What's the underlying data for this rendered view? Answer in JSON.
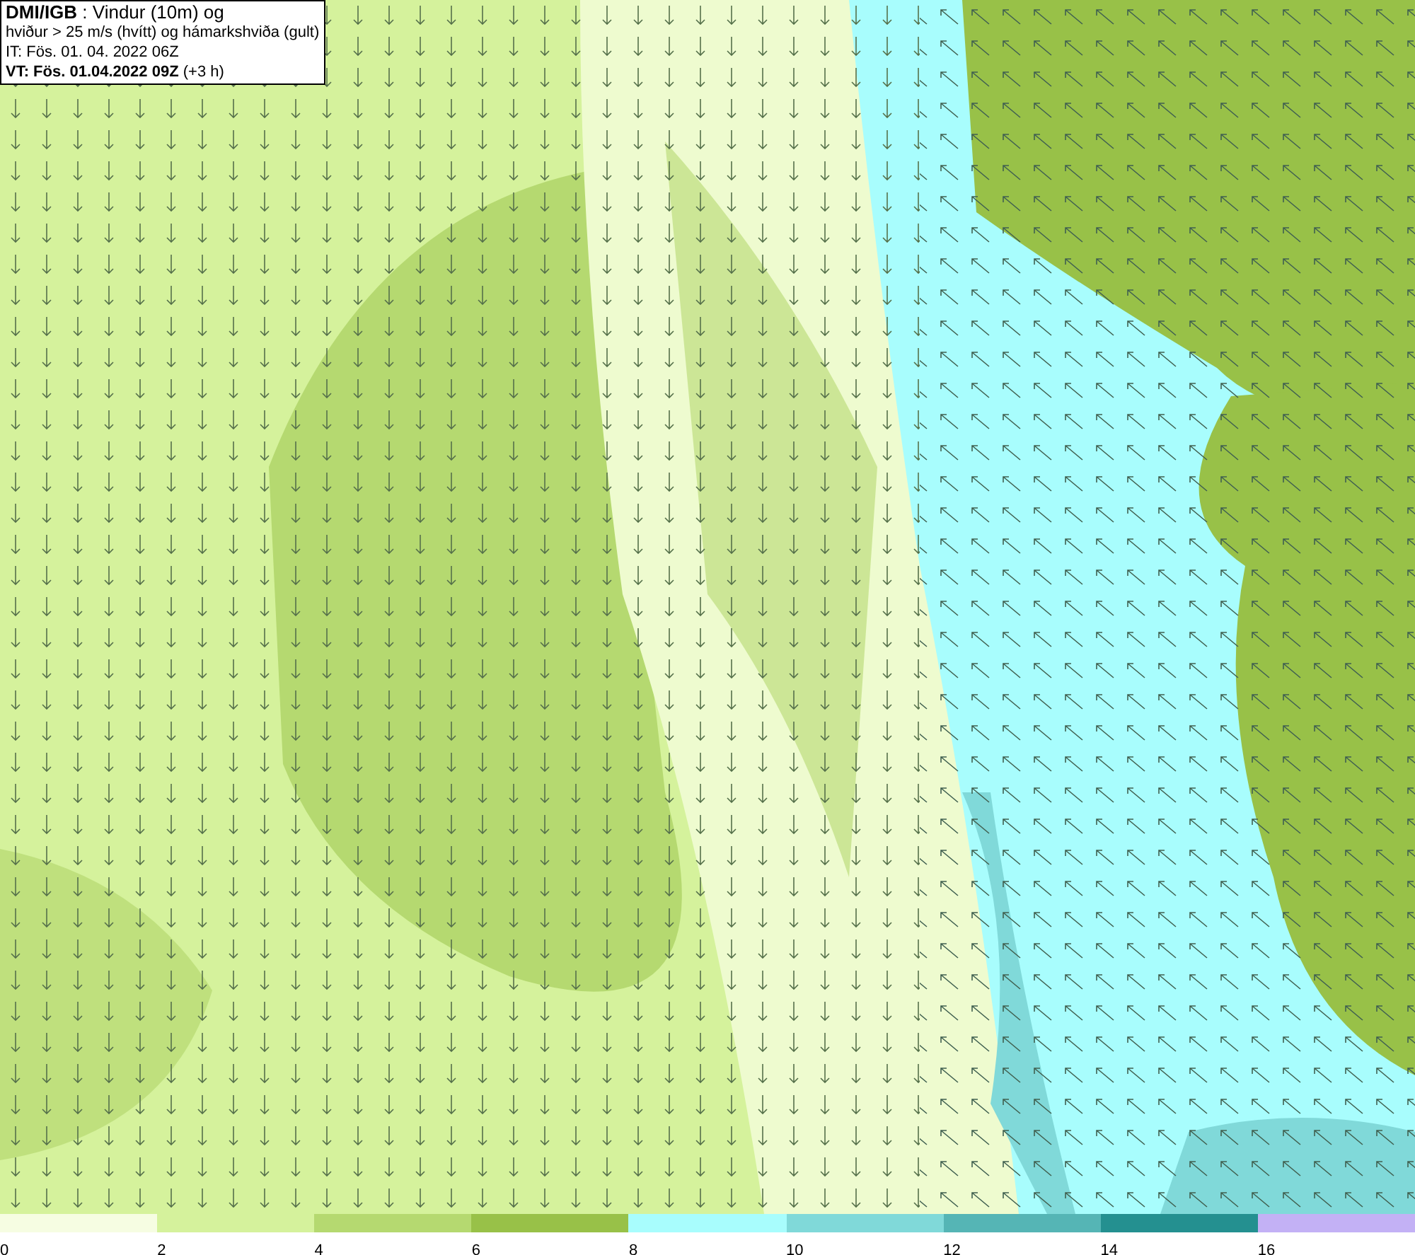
{
  "title_box": {
    "lines": [
      "**DMI/IGB** : Vindur (10m) og",
      "hviður > 25 m/s (hvítt) og hámarkshviða (gult)",
      "IT: Fös. 01. 04. 2022 06Z",
      "**VT: Fös. 01.04.2022 09Z** (+3 h)"
    ]
  },
  "legend": [
    {
      "color": "#f6fde2",
      "label": "0"
    },
    {
      "color": "#d5f29c",
      "label": "2"
    },
    {
      "color": "#b5d970",
      "label": "4"
    },
    {
      "color": "#98c148",
      "label": "6"
    },
    {
      "color": "#a8fdfd",
      "label": "8"
    },
    {
      "color": "#80d9d9",
      "label": "10"
    },
    {
      "color": "#55b5b5",
      "label": "12"
    },
    {
      "color": "#249090",
      "label": "14"
    },
    {
      "color": "#c3b1f5",
      "label": "16"
    }
  ]
}
